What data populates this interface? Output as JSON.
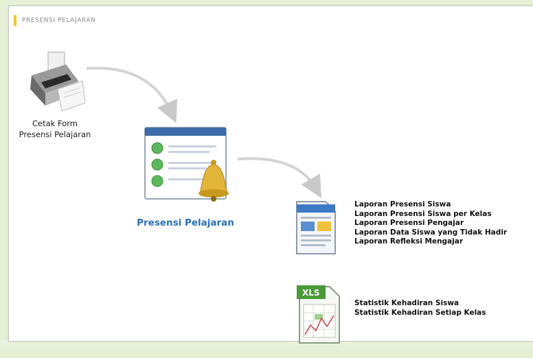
{
  "section": {
    "title": "PRESENSI PELAJARAN"
  },
  "print_form": {
    "line1": "Cetak Form",
    "line2": "Presensi Pelajaran"
  },
  "main": {
    "label": "Presensi Pelajaran"
  },
  "reports": [
    "Laporan Presensi Siswa",
    "Laporan Presensi Siswa per Kelas",
    "Laporan Presensi Pengajar",
    "Laporan Data Siswa yang Tidak Hadir",
    "Laporan Refleksi Mengajar"
  ],
  "xls": {
    "badge": "XLS"
  },
  "statistics": [
    "Statistik Kehadiran Siswa",
    "Statistik Kehadiran Setiap Kelas"
  ],
  "colors": {
    "accent_bar": "#f3c531",
    "main_label": "#2a6fb7",
    "background": "#e6f0d6"
  }
}
